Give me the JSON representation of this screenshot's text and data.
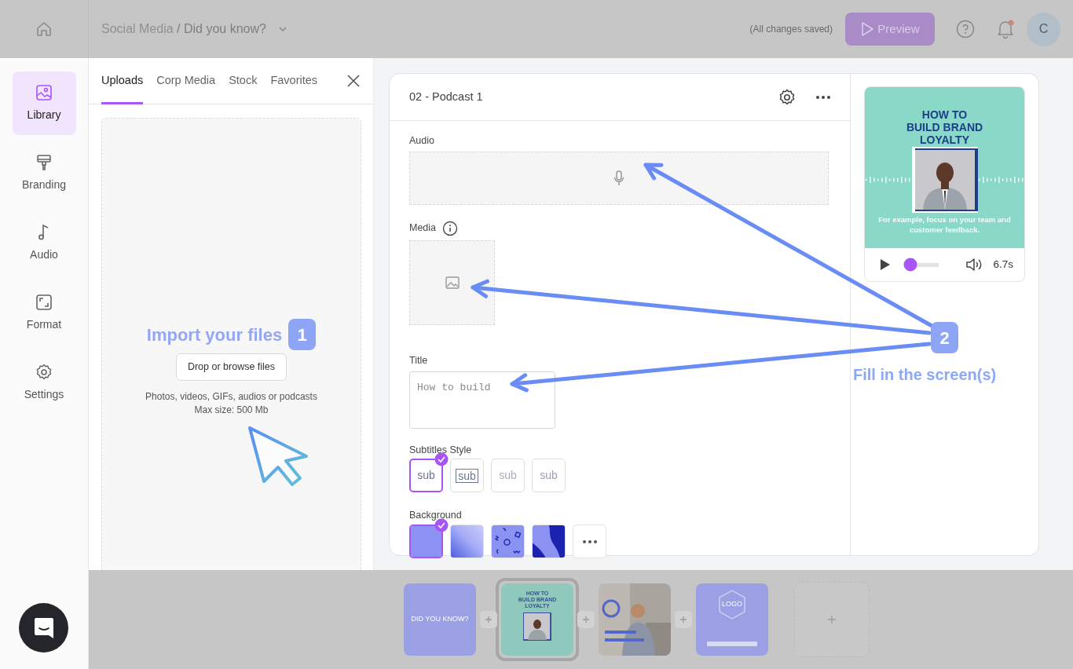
{
  "top_bar": {
    "breadcrumb_parent": "Social Media",
    "breadcrumb_separator": "/",
    "breadcrumb_current": "Did you know?",
    "save_status": "(All changes saved)",
    "preview_button": "Preview",
    "notification_unread": true,
    "avatar_initial": "C"
  },
  "sidebar": {
    "items": [
      {
        "label": "Library",
        "selected": true
      },
      {
        "label": "Branding",
        "selected": false
      },
      {
        "label": "Audio",
        "selected": false
      },
      {
        "label": "Format",
        "selected": false
      },
      {
        "label": "Settings",
        "selected": false
      }
    ]
  },
  "library_panel": {
    "tabs": [
      {
        "label": "Uploads",
        "selected": true
      },
      {
        "label": "Corp Media",
        "selected": false
      },
      {
        "label": "Stock",
        "selected": false
      },
      {
        "label": "Favorites",
        "selected": false
      }
    ],
    "dropzone": {
      "heading": "Import your files",
      "step": "1",
      "button": "Drop or browse files",
      "hint": "Photos, videos, GIFs, audios or podcasts",
      "max_size": "Max size: 500 Mb"
    }
  },
  "editor": {
    "screen_title": "02 - Podcast 1",
    "audio_label": "Audio",
    "media_label": "Media",
    "title_label": "Title",
    "title_placeholder": "How to build",
    "subtitles_label": "Subtitles Style",
    "subtitle_styles": [
      {
        "kind": "plain",
        "text": "sub",
        "selected": true
      },
      {
        "kind": "boxed",
        "text": "sub",
        "selected": false
      },
      {
        "kind": "karaoke",
        "text": "sub",
        "selected": false
      },
      {
        "kind": "faded",
        "text": "sub",
        "selected": false
      }
    ],
    "background_label": "Background",
    "backgrounds": [
      {
        "kind": "solid",
        "selected": true
      },
      {
        "kind": "gradient",
        "selected": false
      },
      {
        "kind": "pattern",
        "selected": false
      },
      {
        "kind": "waves",
        "selected": false
      }
    ]
  },
  "preview": {
    "title_lines": [
      "HOW TO",
      "BUILD BRAND",
      "LOYALTY"
    ],
    "caption": "For example, focus on your team and customer feedback.",
    "player": {
      "playing": false,
      "level": 0.1,
      "duration": "6.7s"
    }
  },
  "annotation": {
    "step": "2",
    "text": "Fill in the screen(s)"
  },
  "timeline": {
    "slides": [
      {
        "kind": "text",
        "text": "DID YOU KNOW?",
        "selected": false
      },
      {
        "kind": "preview",
        "lines": [
          "HOW TO",
          "BUILD BRAND",
          "LOYALTY"
        ],
        "selected": true
      },
      {
        "kind": "picture",
        "selected": false
      },
      {
        "kind": "logo",
        "text": "LOGO",
        "selected": false
      }
    ]
  }
}
